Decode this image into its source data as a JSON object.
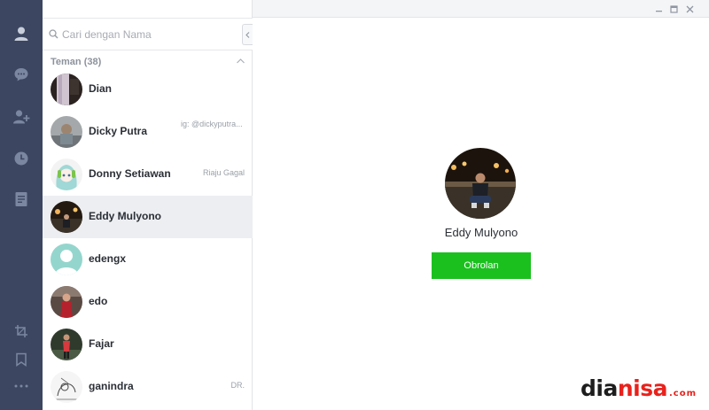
{
  "search": {
    "placeholder": "Cari dengan Nama"
  },
  "group": {
    "label": "Teman (38)"
  },
  "friends": [
    {
      "name": "Dian",
      "status": ""
    },
    {
      "name": "Dicky Putra",
      "status": "ig: @dickyputra..."
    },
    {
      "name": "Donny Setiawan",
      "status": "Riaju Gagal"
    },
    {
      "name": "Eddy Mulyono",
      "status": ""
    },
    {
      "name": "edengx",
      "status": ""
    },
    {
      "name": "edo",
      "status": ""
    },
    {
      "name": "Fajar",
      "status": ""
    },
    {
      "name": "ganindra",
      "status": "DR."
    }
  ],
  "selected_index": 3,
  "profile": {
    "name": "Eddy Mulyono",
    "chat_label": "Obrolan"
  },
  "watermark": {
    "part1": "dia",
    "part2": "nisa",
    "suffix": ".com"
  },
  "colors": {
    "rail": "#3c4660",
    "accent": "#1bc01f",
    "selected_row": "#eceef1"
  },
  "icons": {
    "rail_top": [
      "friends-icon",
      "chats-icon",
      "add-friend-icon",
      "history-icon",
      "notes-icon"
    ],
    "rail_bottom": [
      "screenshot-icon",
      "bookmark-icon",
      "more-icon"
    ]
  }
}
